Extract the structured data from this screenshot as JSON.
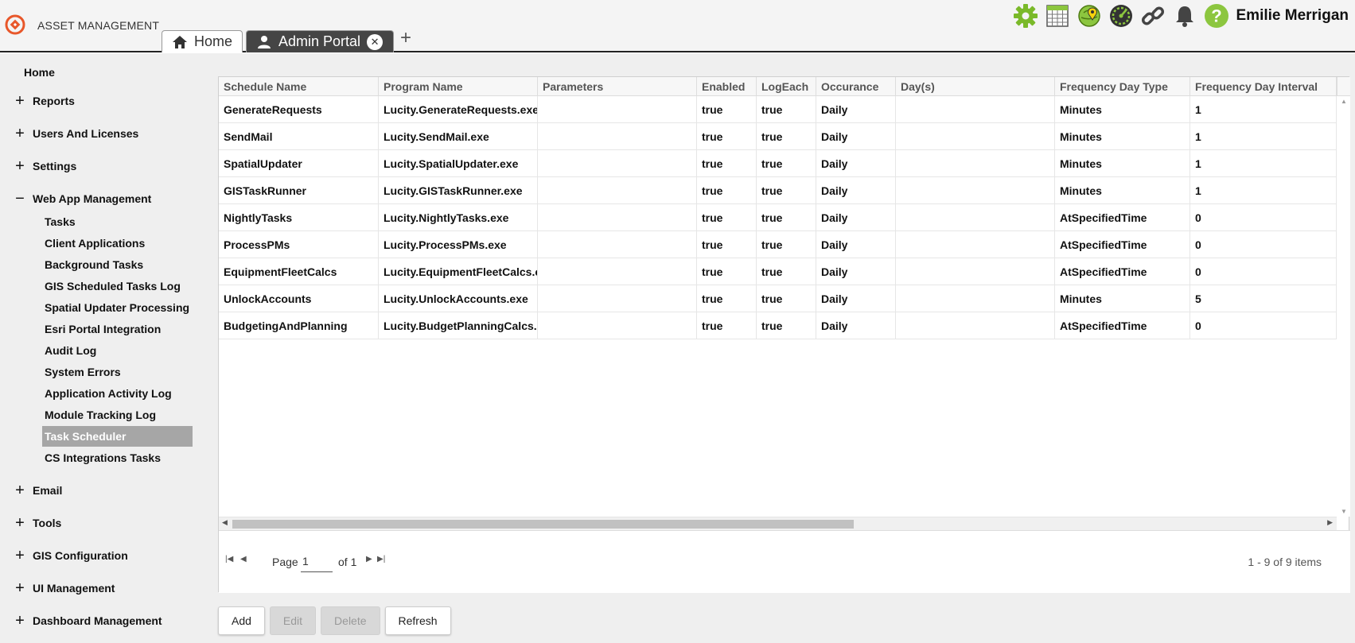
{
  "app": {
    "title": "ASSET MANAGEMENT",
    "user": "Emilie Merrigan"
  },
  "tabs": [
    {
      "label": "Home",
      "icon": "home-icon",
      "active": false
    },
    {
      "label": "Admin Portal",
      "icon": "person-icon",
      "active": true
    }
  ],
  "toolbar": [
    "gear-icon",
    "calendar-icon",
    "map-pin-icon",
    "dashboard-clock-icon",
    "link-icon",
    "bell-icon",
    "help-icon"
  ],
  "colors": {
    "accent_green": "#8cc63f",
    "logo_orange": "#e8572a",
    "active_nav": "#a6a6a6",
    "tab_dark": "#454545"
  },
  "sidebar": {
    "home": "Home",
    "sections_top": [
      {
        "label": "Reports",
        "state": "+"
      },
      {
        "label": "Users And Licenses",
        "state": "+"
      },
      {
        "label": "Settings",
        "state": "+"
      },
      {
        "label": "Web App Management",
        "state": "−"
      }
    ],
    "sub_items": [
      "Tasks",
      "Client Applications",
      "Background Tasks",
      "GIS Scheduled Tasks Log",
      "Spatial Updater Processing",
      "Esri Portal Integration",
      "Audit Log",
      "System Errors",
      "Application Activity Log",
      "Module Tracking Log",
      "Task Scheduler",
      "CS Integrations Tasks"
    ],
    "active_sub": "Task Scheduler",
    "sections_bottom": [
      {
        "label": "Email",
        "state": "+"
      },
      {
        "label": "Tools",
        "state": "+"
      },
      {
        "label": "GIS Configuration",
        "state": "+"
      },
      {
        "label": "UI Management",
        "state": "+"
      },
      {
        "label": "Dashboard Management",
        "state": "+"
      }
    ]
  },
  "grid": {
    "columns": [
      "Schedule Name",
      "Program Name",
      "Parameters",
      "Enabled",
      "LogEach",
      "Occurance",
      "Day(s)",
      "Frequency Day Type",
      "Frequency Day Interval"
    ],
    "rows": [
      [
        "GenerateRequests",
        "Lucity.GenerateRequests.exe",
        "",
        "true",
        "true",
        "Daily",
        "",
        "Minutes",
        "1"
      ],
      [
        "SendMail",
        "Lucity.SendMail.exe",
        "",
        "true",
        "true",
        "Daily",
        "",
        "Minutes",
        "1"
      ],
      [
        "SpatialUpdater",
        "Lucity.SpatialUpdater.exe",
        "",
        "true",
        "true",
        "Daily",
        "",
        "Minutes",
        "1"
      ],
      [
        "GISTaskRunner",
        "Lucity.GISTaskRunner.exe",
        "",
        "true",
        "true",
        "Daily",
        "",
        "Minutes",
        "1"
      ],
      [
        "NightlyTasks",
        "Lucity.NightlyTasks.exe",
        "",
        "true",
        "true",
        "Daily",
        "",
        "AtSpecifiedTime",
        "0"
      ],
      [
        "ProcessPMs",
        "Lucity.ProcessPMs.exe",
        "",
        "true",
        "true",
        "Daily",
        "",
        "AtSpecifiedTime",
        "0"
      ],
      [
        "EquipmentFleetCalcs",
        "Lucity.EquipmentFleetCalcs.exe",
        "",
        "true",
        "true",
        "Daily",
        "",
        "AtSpecifiedTime",
        "0"
      ],
      [
        "UnlockAccounts",
        "Lucity.UnlockAccounts.exe",
        "",
        "true",
        "true",
        "Daily",
        "",
        "Minutes",
        "5"
      ],
      [
        "BudgetingAndPlanning",
        "Lucity.BudgetPlanningCalcs.exe",
        "",
        "true",
        "true",
        "Daily",
        "",
        "AtSpecifiedTime",
        "0"
      ]
    ]
  },
  "pager": {
    "page_label": "Page",
    "page_value": "1",
    "of_label": "of 1",
    "info": "1 - 9 of 9 items"
  },
  "actions": [
    {
      "label": "Add",
      "enabled": true
    },
    {
      "label": "Edit",
      "enabled": false
    },
    {
      "label": "Delete",
      "enabled": false
    },
    {
      "label": "Refresh",
      "enabled": true
    }
  ]
}
